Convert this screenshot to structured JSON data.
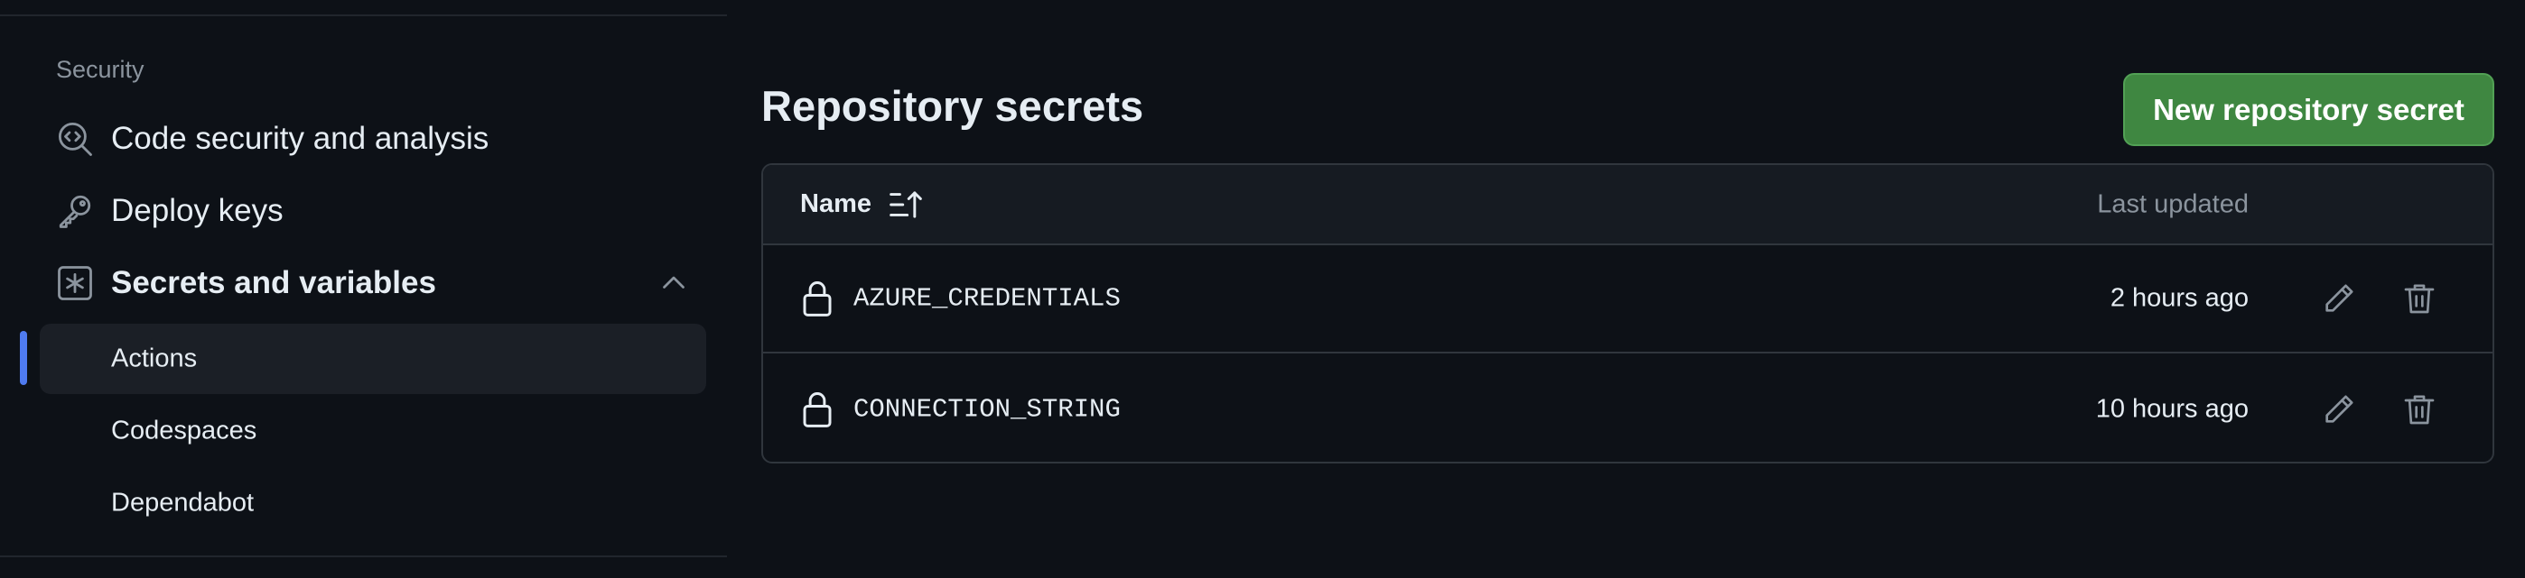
{
  "sidebar": {
    "section_heading": "Security",
    "items": [
      {
        "label": "Code security and analysis",
        "icon": "codescan-icon"
      },
      {
        "label": "Deploy keys",
        "icon": "key-icon"
      },
      {
        "label": "Secrets and variables",
        "icon": "asterisk-icon",
        "expanded": true
      }
    ],
    "sub_items": [
      {
        "label": "Actions",
        "active": true
      },
      {
        "label": "Codespaces",
        "active": false
      },
      {
        "label": "Dependabot",
        "active": false
      }
    ]
  },
  "main": {
    "title": "Repository secrets",
    "new_secret_button": "New repository secret",
    "table": {
      "columns": {
        "name": "Name",
        "last_updated": "Last updated"
      },
      "rows": [
        {
          "name": "AZURE_CREDENTIALS",
          "updated": "2 hours ago"
        },
        {
          "name": "CONNECTION_STRING",
          "updated": "10 hours ago"
        }
      ]
    }
  },
  "colors": {
    "background": "#0d1117",
    "accent_button": "#3f8741",
    "active_marker": "#4f7bf0",
    "muted_text": "#8b949e"
  }
}
